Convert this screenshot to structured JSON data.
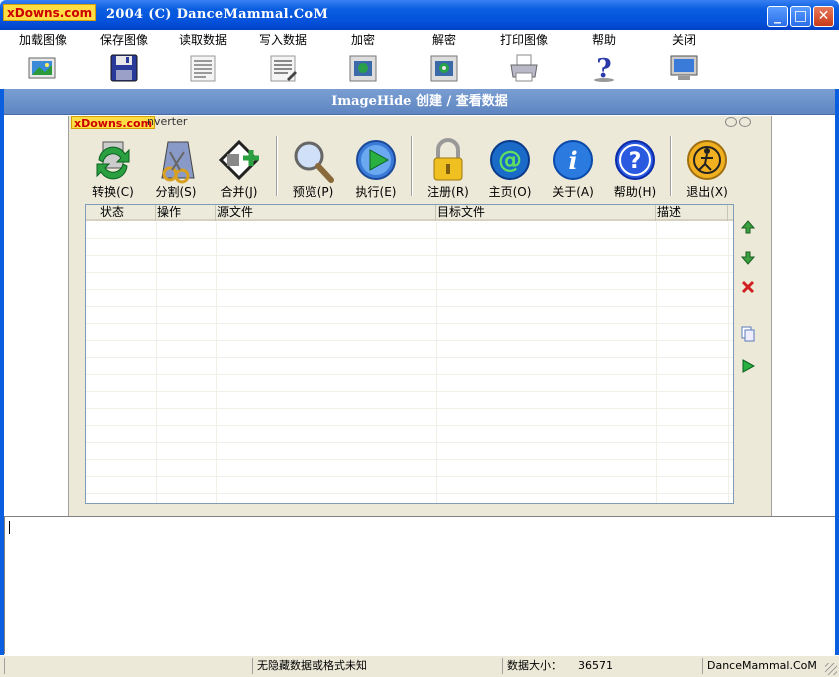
{
  "window": {
    "watermark": "xDowns.com",
    "title": "2004 (C) DanceMammal.CoM",
    "controls": {
      "minimize": "_",
      "maximize": "□",
      "close": "✕"
    }
  },
  "main_toolbar": {
    "items": [
      {
        "label": "加载图像",
        "icon": "load-image-icon"
      },
      {
        "label": "保存图像",
        "icon": "floppy-disk-icon"
      },
      {
        "label": "读取数据",
        "icon": "read-data-icon"
      },
      {
        "label": "写入数据",
        "icon": "write-data-icon"
      },
      {
        "label": "加密",
        "icon": "encrypt-icon"
      },
      {
        "label": "解密",
        "icon": "decrypt-icon"
      },
      {
        "label": "打印图像",
        "icon": "printer-icon"
      },
      {
        "label": "帮助",
        "icon": "help-question-icon"
      },
      {
        "label": "关闭",
        "icon": "monitor-close-icon"
      }
    ]
  },
  "header": {
    "title": "ImageHide 创建 / 查看数据"
  },
  "inner_window": {
    "watermark": "xDowns.com",
    "title_fragment": "nverter",
    "toolbar": [
      {
        "label": "转换(C)",
        "icon": "convert-icon"
      },
      {
        "label": "分割(S)",
        "icon": "split-icon"
      },
      {
        "label": "合并(J)",
        "icon": "join-icon"
      },
      {
        "label": "预览(P)",
        "icon": "magnifier-icon"
      },
      {
        "label": "执行(E)",
        "icon": "play-icon"
      },
      {
        "label": "注册(R)",
        "icon": "lock-icon"
      },
      {
        "label": "主页(O)",
        "icon": "at-sign-icon"
      },
      {
        "label": "关于(A)",
        "icon": "info-icon"
      },
      {
        "label": "帮助(H)",
        "icon": "question-icon"
      },
      {
        "label": "退出(X)",
        "icon": "exit-icon"
      }
    ],
    "list": {
      "columns": [
        "状态",
        "操作",
        "源文件",
        "目标文件",
        "描述"
      ],
      "rows": []
    },
    "side_buttons": [
      "move-up-icon",
      "move-down-icon",
      "delete-icon",
      "copy-icon",
      "run-icon"
    ]
  },
  "statusbar": {
    "message": "无隐藏数据或格式未知",
    "size_label": "数据大小：",
    "size_value": "36571",
    "brand": "DanceMammal.CoM"
  },
  "colors": {
    "titlebar": "#0a5ee0",
    "header": "#6b8fc8",
    "window_bg": "#ece9d8",
    "watermark_bg": "#ffdd44",
    "watermark_fg": "#cc0000"
  }
}
